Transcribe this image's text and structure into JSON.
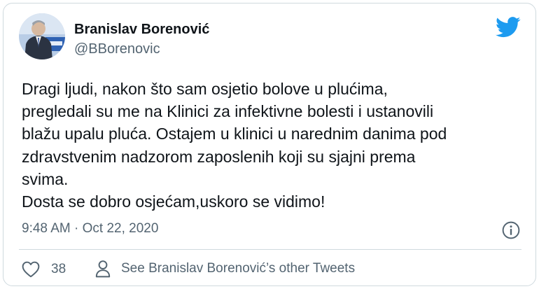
{
  "author": {
    "name": "Branislav Borenović",
    "handle": "@BBorenovic"
  },
  "tweet": {
    "text": "Dragi ljudi, nakon što sam osjetio bolove u plućima,\npregledali su me na Klinici za infektivne bolesti i ustanovili\nblažu upalu pluća. Ostajem u klinici u narednim danima pod\nzdravstvenim nadzorom zaposlenih koji su sjajni prema\nsvima.\nDosta se dobro osjećam,uskoro se vidimo!",
    "time": "9:48 AM",
    "separator": "·",
    "date": "Oct 22, 2020"
  },
  "actions": {
    "like_count": "38",
    "other_tweets_label": "See Branislav Borenović’s other Tweets"
  },
  "icons": {
    "brand": "twitter-bird-icon",
    "info": "info-icon",
    "like": "heart-icon",
    "profile": "person-icon"
  },
  "colors": {
    "twitter_blue": "#1d9bf0",
    "text_primary": "#0f1419",
    "text_secondary": "#536471",
    "border": "#cfd9de"
  }
}
